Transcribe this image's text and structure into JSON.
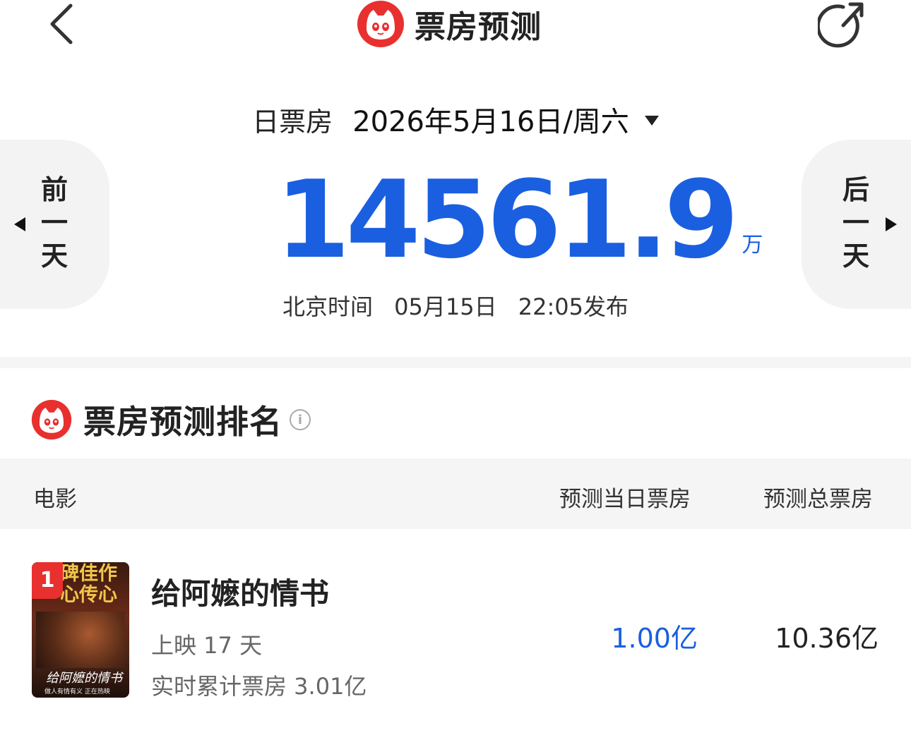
{
  "header": {
    "title": "票房预测",
    "back_icon": "chevron-left-icon",
    "share_icon": "share-icon",
    "logo_color": "#e8302e"
  },
  "date_selector": {
    "label": "日票房",
    "value": "2026年5月16日/周六"
  },
  "nav": {
    "prev": "前一天",
    "next": "后一天"
  },
  "summary": {
    "value": "14561.9",
    "unit": "万",
    "publish_prefix": "北京时间",
    "publish_date": "05月15日",
    "publish_time": "22:05发布",
    "accent_color": "#1a5fe0"
  },
  "ranking": {
    "title": "票房预测排名",
    "columns": {
      "movie": "电影",
      "day": "预测当日票房",
      "total": "预测总票房"
    },
    "rows": [
      {
        "rank": "1",
        "poster_tagline": "碑佳作\n心传心",
        "poster_title": "给阿嬷的情书",
        "poster_subtitle": "做人有情有义 正在热映",
        "name": "给阿嬷的情书",
        "days": "上映 17 天",
        "cumulative": "实时累计票房 3.01亿",
        "day_forecast": "1.00亿",
        "total_forecast": "10.36亿"
      }
    ]
  }
}
